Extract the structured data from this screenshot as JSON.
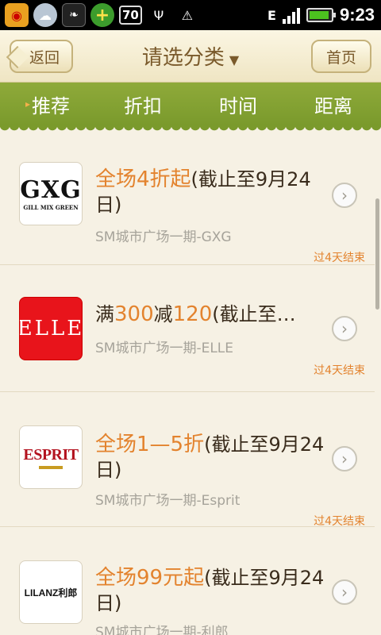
{
  "status_bar": {
    "battery_text": "70",
    "network": "E",
    "time": "9:23"
  },
  "header": {
    "back_label": "返回",
    "title": "请选分类",
    "home_label": "首页"
  },
  "tabs": [
    {
      "label": "推荐"
    },
    {
      "label": "折扣"
    },
    {
      "label": "时间"
    },
    {
      "label": "距离"
    }
  ],
  "items": [
    {
      "logo_icon": "gxg-logo",
      "logo_text": "GXG",
      "logo_sub": "GILL MIX GREEN",
      "offer_highlight": "全场4折起",
      "offer_rest": "(截止至9月24日)",
      "store": "SM城市广场一期-GXG",
      "ends": "过4天结束"
    },
    {
      "logo_icon": "elle-logo",
      "logo_text": "ELLE",
      "offer_pre": "满",
      "offer_h1": "300",
      "offer_mid": "减",
      "offer_h2": "120",
      "offer_rest": "(截止至…",
      "store": "SM城市广场一期-ELLE",
      "ends": "过4天结束"
    },
    {
      "logo_icon": "esprit-logo",
      "logo_text": "ESPRIT",
      "offer_highlight": "全场1—5折",
      "offer_rest": "(截止至9月24日)",
      "store": "SM城市广场一期-Esprit",
      "ends": "过4天结束"
    },
    {
      "logo_icon": "lilanz-logo",
      "logo_text": "LILANZ利郎",
      "offer_highlight": "全场99元起",
      "offer_rest": "(截止至9月24日)",
      "store": "SM城市广场一期-利郎",
      "ends": ""
    }
  ]
}
